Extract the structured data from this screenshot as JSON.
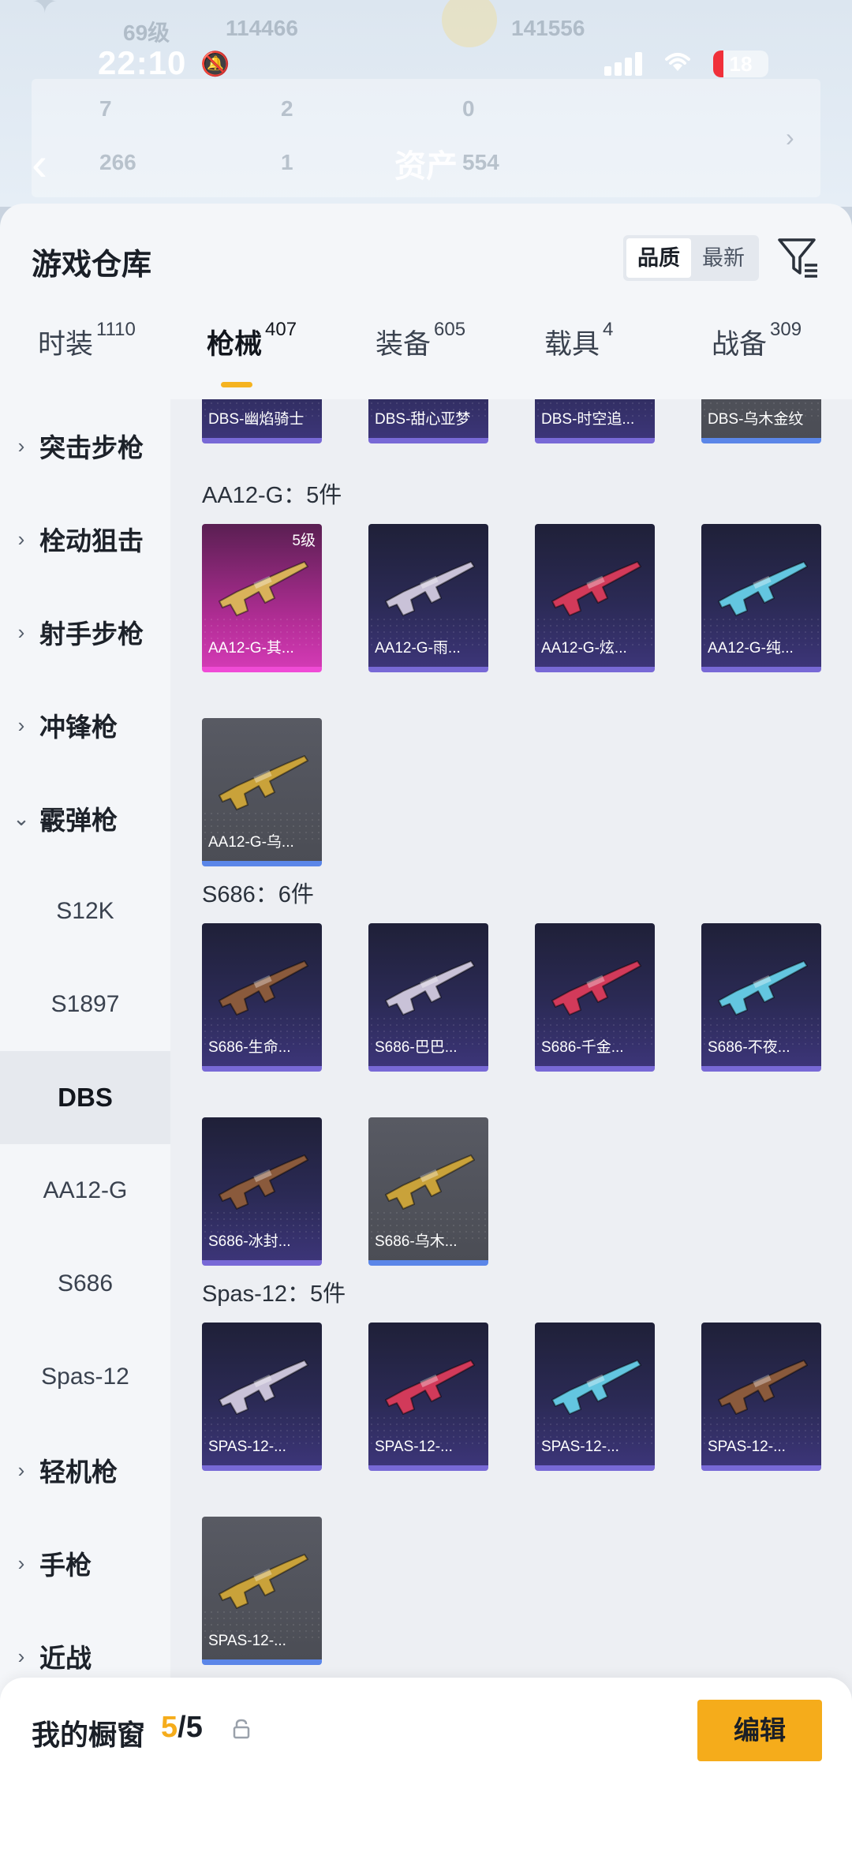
{
  "status_bar": {
    "time": "22:10",
    "battery": "18",
    "battery_level": 0.18
  },
  "background": {
    "level_text": "69级",
    "coins": "114466",
    "points": "141556",
    "stats": [
      "7",
      "2",
      "0",
      "266",
      "1",
      "554"
    ],
    "title": "资产"
  },
  "sheet": {
    "title": "游戏仓库"
  },
  "sort": {
    "options": [
      "品质",
      "最新"
    ],
    "active": "品质"
  },
  "tabs": [
    {
      "label": "时装",
      "count": "1110"
    },
    {
      "label": "枪械",
      "count": "407"
    },
    {
      "label": "装备",
      "count": "605"
    },
    {
      "label": "载具",
      "count": "4"
    },
    {
      "label": "战备",
      "count": "309"
    }
  ],
  "sidebar": {
    "categories": [
      {
        "label": "突击步枪"
      },
      {
        "label": "栓动狙击"
      },
      {
        "label": "射手步枪"
      },
      {
        "label": "冲锋枪"
      },
      {
        "label": "霰弹枪"
      }
    ],
    "subitems": [
      "S12K",
      "S1897",
      "DBS",
      "AA12-G",
      "S686",
      "Spas-12"
    ],
    "active_sub": "DBS",
    "more_categories": [
      {
        "label": "轻机枪"
      },
      {
        "label": "手枪"
      },
      {
        "label": "近战"
      }
    ]
  },
  "groups": {
    "dbs_top": {
      "items": [
        {
          "label": "DBS-幽焰骑士",
          "rarity": "purple"
        },
        {
          "label": "DBS-甜心亚梦",
          "rarity": "purple"
        },
        {
          "label": "DBS-时空追...",
          "rarity": "purple"
        },
        {
          "label": "DBS-乌木金纹",
          "rarity": "gray"
        }
      ]
    },
    "aa12": {
      "title": "AA12-G：5件",
      "items": [
        {
          "label": "AA12-G-其...",
          "rarity": "pink",
          "level": "5级"
        },
        {
          "label": "AA12-G-雨...",
          "rarity": "purple"
        },
        {
          "label": "AA12-G-炫...",
          "rarity": "purple"
        },
        {
          "label": "AA12-G-纯...",
          "rarity": "purple"
        },
        {
          "label": "AA12-G-乌...",
          "rarity": "gray"
        }
      ]
    },
    "s686": {
      "title": "S686：6件",
      "items": [
        {
          "label": "S686-生命...",
          "rarity": "purple"
        },
        {
          "label": "S686-巴巴...",
          "rarity": "purple"
        },
        {
          "label": "S686-千金...",
          "rarity": "purple"
        },
        {
          "label": "S686-不夜...",
          "rarity": "purple"
        },
        {
          "label": "S686-冰封...",
          "rarity": "purple"
        },
        {
          "label": "S686-乌木...",
          "rarity": "gray"
        }
      ]
    },
    "spas12": {
      "title": "Spas-12：5件",
      "items": [
        {
          "label": "SPAS-12-...",
          "rarity": "purple"
        },
        {
          "label": "SPAS-12-...",
          "rarity": "purple"
        },
        {
          "label": "SPAS-12-...",
          "rarity": "purple"
        },
        {
          "label": "SPAS-12-...",
          "rarity": "purple"
        },
        {
          "label": "SPAS-12-...",
          "rarity": "gray"
        }
      ]
    }
  },
  "showcase": {
    "label": "我的橱窗",
    "current": "5",
    "sep": "/",
    "max": "5",
    "edit_label": "编辑"
  },
  "colors": {
    "accent": "#f5ac1b",
    "purple_edge": "#7869d6",
    "pink_edge": "#f04bd6",
    "gray_edge": "#5b86e8"
  }
}
